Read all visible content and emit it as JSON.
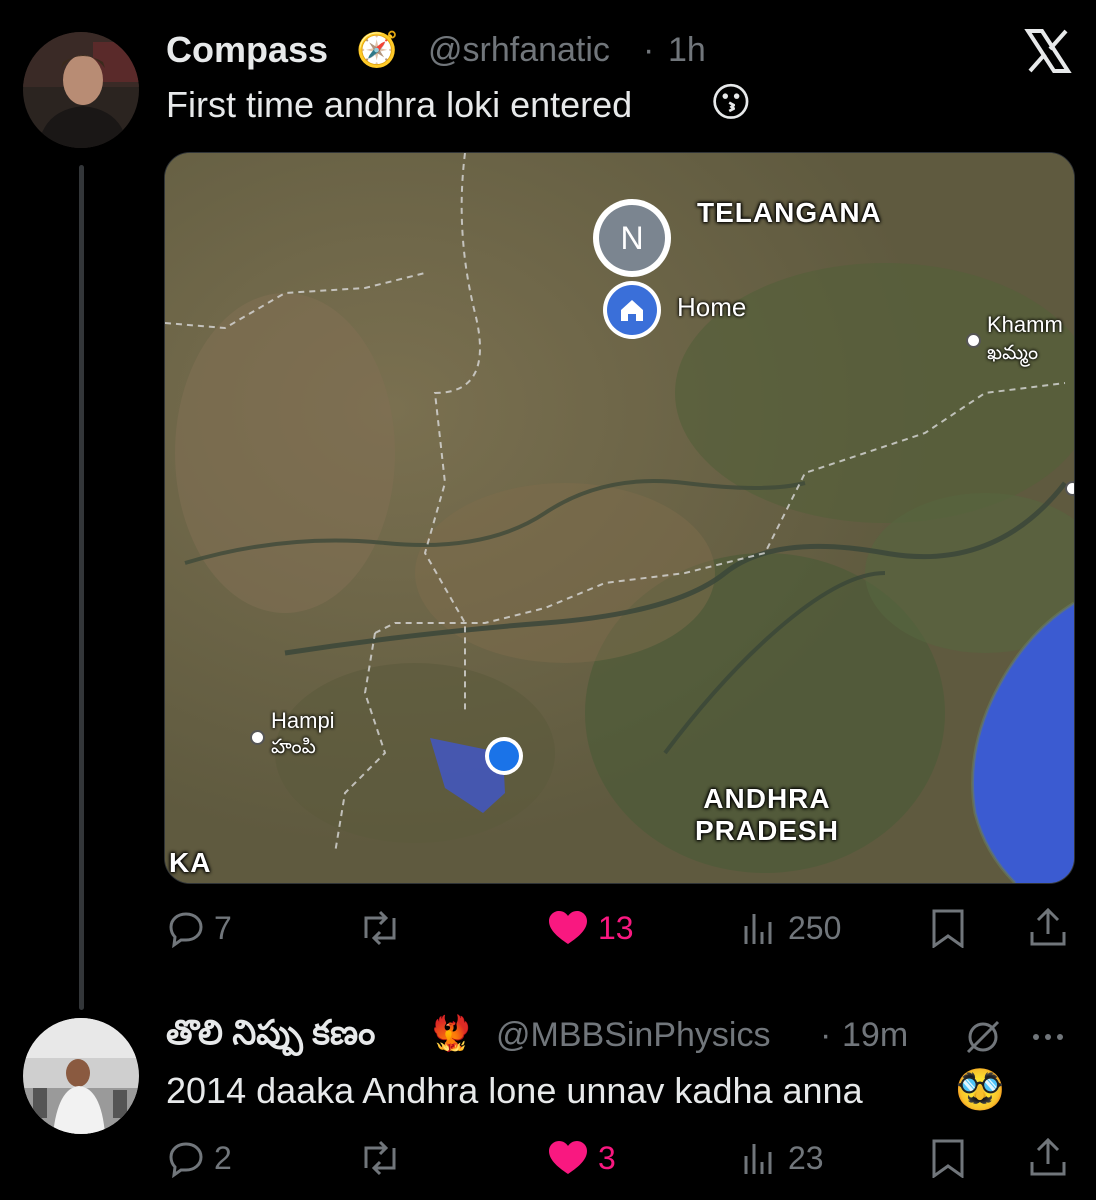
{
  "post": {
    "author_name": "Compass",
    "author_emoji": "🧭",
    "handle": "@srhfanatic",
    "separator": "·",
    "time": "1h",
    "text": "First time andhra loki entered",
    "text_emoji": "😗",
    "close_label": "X",
    "actions": {
      "replies": "7",
      "reposts": "",
      "likes": "13",
      "views": "250"
    }
  },
  "map": {
    "labels": {
      "telangana": "TELANGANA",
      "andhra": "ANDHRA\nPRADESH",
      "ka": "KA",
      "home": "Home",
      "khammam_en": "Khamm",
      "khammam_te": "ఖమ్మం",
      "hampi_en": "Hampi",
      "hampi_te": "హంపి",
      "n_marker": "N"
    },
    "colors": {
      "land": "#6d6448",
      "water": "#3b5bd1",
      "location_dot": "#1a73e8"
    }
  },
  "reply": {
    "author_name": "తొలి నిప్పు కణం",
    "author_emoji": "🐦‍🔥",
    "handle": "@MBBSinPhysics",
    "separator": "·",
    "time": "19m",
    "text": "2014 daaka Andhra lone unnav kadha anna",
    "text_emoji": "🥸",
    "actions": {
      "replies": "2",
      "reposts": "",
      "likes": "3",
      "views": "23"
    }
  },
  "colors": {
    "like": "#f91880",
    "muted": "#71767b",
    "text": "#e7e9ea"
  }
}
